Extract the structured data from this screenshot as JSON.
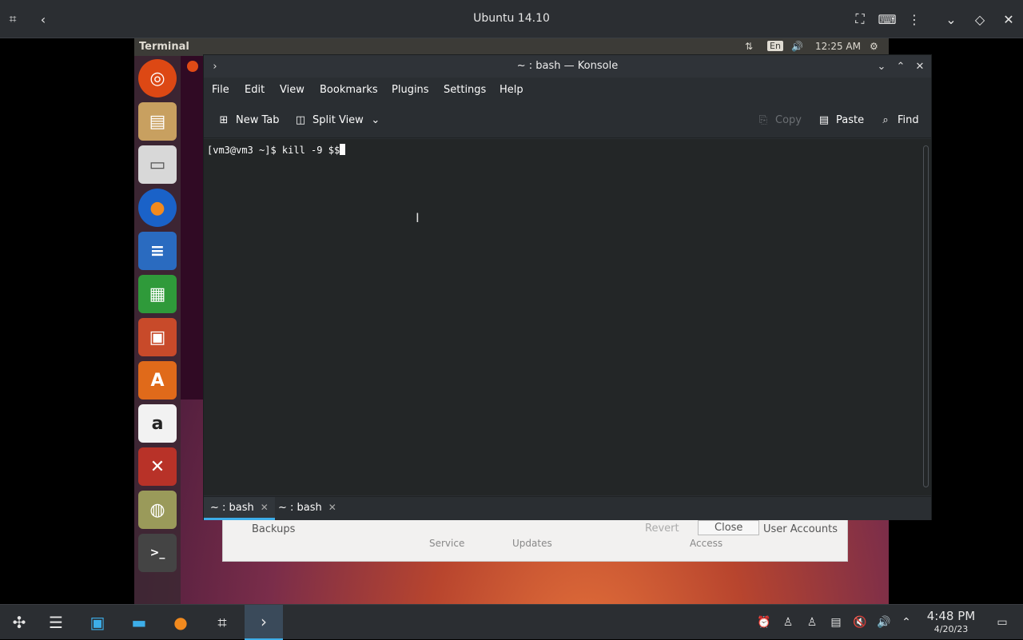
{
  "host": {
    "window_title": "Ubuntu 14.10",
    "taskbar": {
      "clock_time": "4:48 PM",
      "clock_date": "4/20/23"
    }
  },
  "guest": {
    "panel_title": "Terminal",
    "keyboard_layout": "En",
    "clock": "12:25 AM",
    "settings_dialog": {
      "backups": "Backups",
      "revert": "Revert",
      "close": "Close",
      "user_accounts": "User Accounts",
      "service": "Service",
      "updates": "Updates",
      "access": "Access"
    }
  },
  "konsole": {
    "title": "~ : bash — Konsole",
    "menu": [
      "File",
      "Edit",
      "View",
      "Bookmarks",
      "Plugins",
      "Settings",
      "Help"
    ],
    "toolbar": {
      "new_tab": "New Tab",
      "split_view": "Split View",
      "copy": "Copy",
      "paste": "Paste",
      "find": "Find"
    },
    "terminal_line": "[vm3@vm3 ~]$ kill -9 $$",
    "tabs": [
      "~ : bash",
      "~ : bash"
    ]
  },
  "colors": {
    "accent": "#3daee9",
    "ubuntu_orange": "#df4a16"
  }
}
